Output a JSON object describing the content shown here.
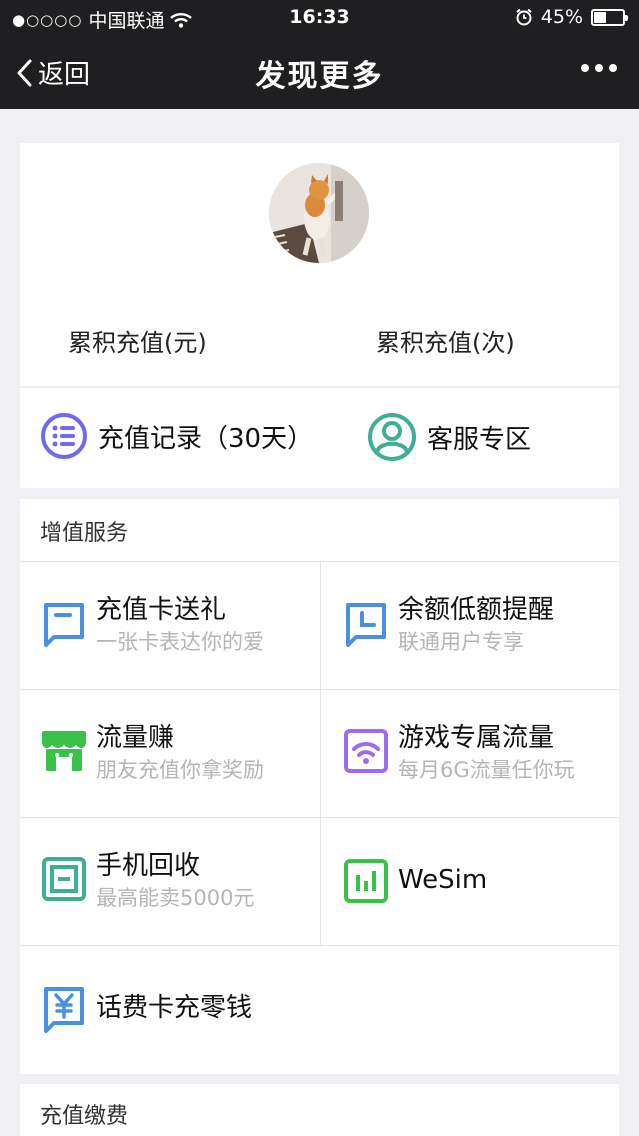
{
  "status_bar": {
    "carrier": "中国联通",
    "time": "16:33",
    "battery": "45%",
    "battery_level": 0.45
  },
  "nav": {
    "back_label": "返回",
    "title": "发现更多"
  },
  "profile": {
    "stat_left": "累积充值(元)",
    "stat_right": "累积充值(次)"
  },
  "quick": {
    "records_label": "充值记录（30天）",
    "service_label": "客服专区"
  },
  "value_added": {
    "title": "增值服务",
    "items": [
      {
        "title": "充值卡送礼",
        "subtitle": "一张卡表达你的爱",
        "icon": "gift-card-icon"
      },
      {
        "title": "余额低额提醒",
        "subtitle": "联通用户专享",
        "icon": "clock-icon"
      },
      {
        "title": "流量赚",
        "subtitle": "朋友充值你拿奖励",
        "icon": "store-icon"
      },
      {
        "title": "游戏专属流量",
        "subtitle": "每月6G流量任你玩",
        "icon": "wifi-icon"
      },
      {
        "title": "手机回收",
        "subtitle": "最高能卖5000元",
        "icon": "phone-recycle-icon"
      },
      {
        "title": "WeSim",
        "subtitle": "",
        "icon": "wesim-icon"
      },
      {
        "title": "话费卡充零钱",
        "subtitle": "",
        "icon": "yuan-card-icon"
      }
    ]
  },
  "payment": {
    "title": "充值缴费"
  },
  "colors": {
    "nav_bg": "#1f1f21",
    "purple": "#6d6cf0",
    "teal": "#3fae96",
    "blue": "#4a90e2",
    "green": "#39c24a",
    "violet": "#9b6cf0"
  }
}
